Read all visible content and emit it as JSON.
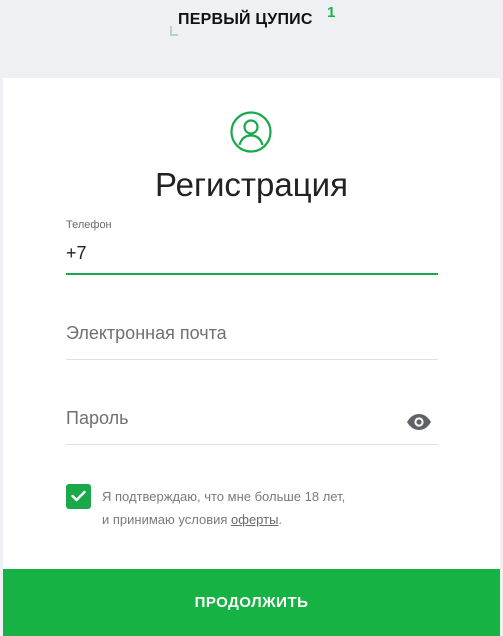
{
  "brand": {
    "name": "ПЕРВЫЙ ЦУПИС",
    "superscript": "1",
    "accent_color": "#16b243"
  },
  "form": {
    "title": "Регистрация",
    "phone": {
      "label": "Телефон",
      "value": "+7"
    },
    "email": {
      "placeholder": "Электронная почта",
      "value": ""
    },
    "password": {
      "placeholder": "Пароль",
      "value": "",
      "toggle_icon": "eye-icon"
    },
    "agreement": {
      "checked": true,
      "text_before": "Я подтверждаю, что мне больше 18 лет,",
      "text_line2": "и принимаю условия ",
      "link_text": "оферты",
      "text_after": "."
    },
    "submit_label": "ПРОДОЛЖИТЬ"
  }
}
